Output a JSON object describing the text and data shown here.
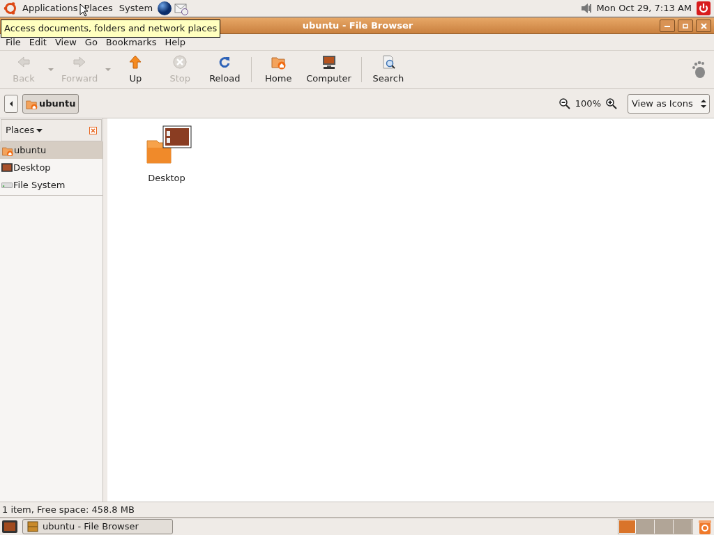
{
  "top_panel": {
    "menus": [
      "Applications",
      "Places",
      "System"
    ],
    "clock": "Mon Oct 29,  7:13 AM"
  },
  "tooltip": "Access documents, folders and network places",
  "window": {
    "title": "ubuntu - File Browser"
  },
  "menubar": [
    "File",
    "Edit",
    "View",
    "Go",
    "Bookmarks",
    "Help"
  ],
  "toolbar": [
    {
      "kind": "button",
      "label": "Back",
      "disabled": true,
      "menu": true
    },
    {
      "kind": "button",
      "label": "Forward",
      "disabled": true,
      "menu": true
    },
    {
      "kind": "button",
      "label": "Up",
      "disabled": false,
      "menu": false
    },
    {
      "kind": "button",
      "label": "Stop",
      "disabled": true,
      "menu": false
    },
    {
      "kind": "button",
      "label": "Reload",
      "disabled": false,
      "menu": false
    },
    {
      "kind": "separator"
    },
    {
      "kind": "button",
      "label": "Home",
      "disabled": false,
      "menu": false
    },
    {
      "kind": "button",
      "label": "Computer",
      "disabled": false,
      "menu": false
    },
    {
      "kind": "separator"
    },
    {
      "kind": "button",
      "label": "Search",
      "disabled": false,
      "menu": false
    }
  ],
  "location": {
    "crumb": "ubuntu",
    "zoom": "100%",
    "view": "View as Icons"
  },
  "sidebar": {
    "title": "Places",
    "items": [
      {
        "label": "ubuntu",
        "selected": true
      },
      {
        "label": "Desktop",
        "selected": false
      },
      {
        "label": "File System",
        "selected": false
      }
    ]
  },
  "files": [
    {
      "label": "Desktop"
    }
  ],
  "status_bar": "1 item, Free space: 458.8 MB",
  "taskbar": {
    "tasks": [
      {
        "label": "ubuntu - File Browser",
        "selected": false
      }
    ],
    "workspaces": [
      {
        "selected": true
      },
      {
        "selected": false
      },
      {
        "selected": false
      },
      {
        "selected": false
      }
    ]
  }
}
